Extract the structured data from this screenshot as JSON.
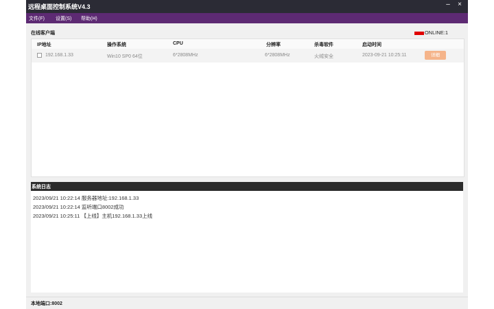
{
  "window": {
    "title": "远程桌面控制系统V4.3",
    "minimize": "–",
    "close": "×"
  },
  "menu": [
    {
      "label": "文件(F)"
    },
    {
      "label": "设置(S)"
    },
    {
      "label": "帮助(H)"
    }
  ],
  "clients": {
    "section_title": "在线客户端",
    "online_text": "ONLINE:1",
    "online_color": "#e00000",
    "columns": [
      "IP地址",
      "操作系统",
      "CPU",
      "分辨率",
      "杀毒软件",
      "启动时间"
    ],
    "rows": [
      {
        "ip": "192.168.1.33",
        "os": "Win10 SP0  64位",
        "cpu": "6*2808MHz",
        "resolution": "6*2808MHz",
        "antivirus": "火绒安全",
        "start_time": "2023-09-21 10:25:11",
        "action": "详细"
      }
    ]
  },
  "log": {
    "title": "系统日志",
    "lines": [
      "2023/09/21 10:22:14 服务器地址:192.168.1.33",
      "2023/09/21 10:22:14 监听端口8002成功",
      "2023/09/21 10:25:11 【上线】主机192.168.1.33上线"
    ]
  },
  "status": {
    "text": "本地端口:8002"
  }
}
